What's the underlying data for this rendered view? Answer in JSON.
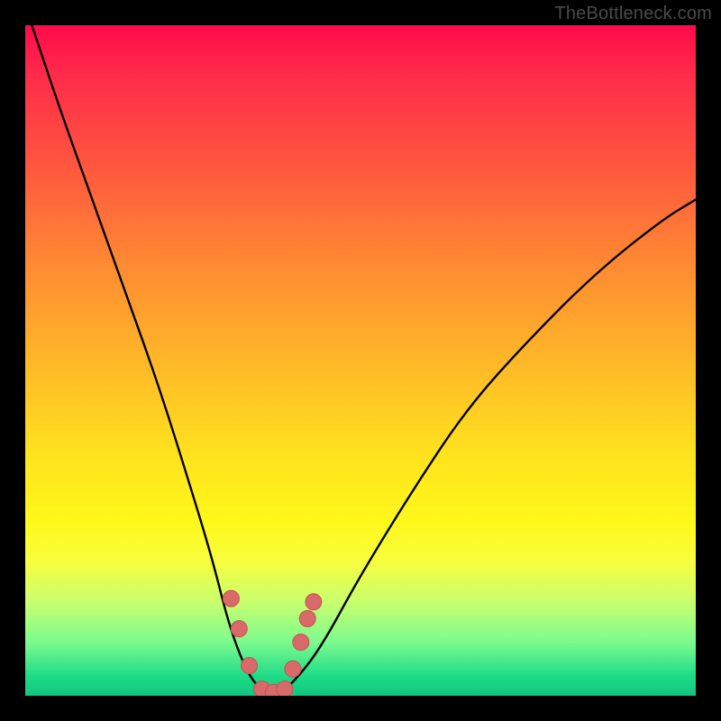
{
  "watermark": "TheBottleneck.com",
  "chart_data": {
    "type": "line",
    "title": "",
    "xlabel": "",
    "ylabel": "",
    "xlim": [
      0,
      100
    ],
    "ylim": [
      0,
      100
    ],
    "series": [
      {
        "name": "bottleneck-curve",
        "x": [
          1,
          5,
          10,
          15,
          20,
          25,
          28,
          30,
          32,
          34,
          36,
          38,
          40,
          44,
          50,
          58,
          66,
          75,
          85,
          95,
          100
        ],
        "y": [
          100,
          88,
          74,
          60,
          46,
          30,
          20,
          12,
          6,
          2,
          0.5,
          0.5,
          2,
          7,
          18,
          31,
          43,
          53,
          63,
          71,
          74
        ]
      }
    ],
    "markers": {
      "name": "sample-points",
      "x_pct": [
        30.7,
        31.9,
        33.4,
        35.3,
        37.0,
        38.7,
        39.9,
        41.1,
        42.1,
        43.0
      ],
      "y_val": [
        14.5,
        10.0,
        4.5,
        1.0,
        0.5,
        1.0,
        4.0,
        8.0,
        11.5,
        14.0
      ]
    },
    "gradient_stops": [
      {
        "pos": 0.0,
        "color": "#ff0a4a"
      },
      {
        "pos": 0.07,
        "color": "#ff2a4a"
      },
      {
        "pos": 0.22,
        "color": "#ff5a3e"
      },
      {
        "pos": 0.36,
        "color": "#ff8b32"
      },
      {
        "pos": 0.5,
        "color": "#ffb728"
      },
      {
        "pos": 0.64,
        "color": "#ffe21e"
      },
      {
        "pos": 0.74,
        "color": "#fff81a"
      },
      {
        "pos": 0.8,
        "color": "#f7fe3e"
      },
      {
        "pos": 0.86,
        "color": "#c9ff6e"
      },
      {
        "pos": 0.92,
        "color": "#7cfb8e"
      },
      {
        "pos": 0.97,
        "color": "#1fdc88"
      },
      {
        "pos": 1.0,
        "color": "#13c57e"
      }
    ],
    "colors": {
      "curve_stroke": "#000000",
      "marker_fill": "#d86a6a",
      "marker_stroke": "#c85050",
      "frame": "#000000",
      "watermark": "#4a4a4a"
    }
  }
}
